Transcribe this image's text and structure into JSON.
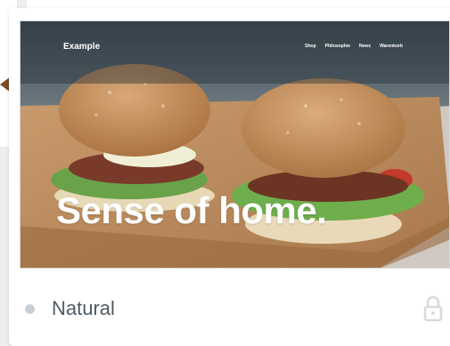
{
  "card": {
    "preview": {
      "site_logo": "Example",
      "nav": [
        "Shop",
        "Philosophie",
        "News",
        "Warenkorb"
      ],
      "headline": "Sense of home."
    },
    "theme_name": "Natural",
    "status_icon": "status-dot-icon",
    "lock_icon": "lock-icon"
  }
}
